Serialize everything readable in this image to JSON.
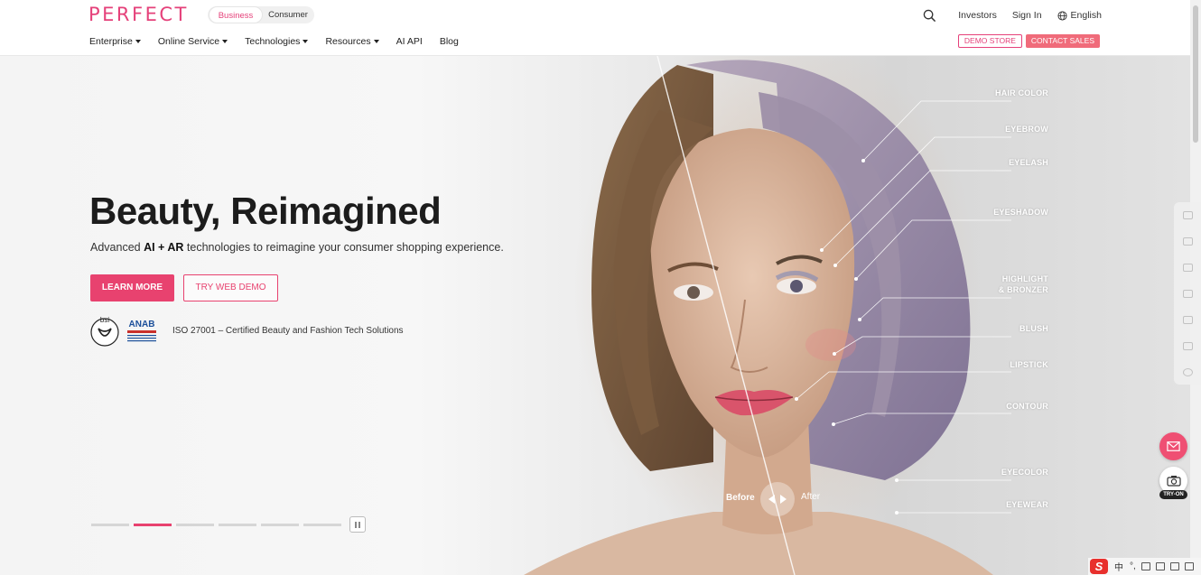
{
  "header": {
    "logo": "PERFECT",
    "toggle": {
      "active": "Business",
      "inactive": "Consumer"
    },
    "links": {
      "investors": "Investors",
      "sign_in": "Sign In",
      "language": "English"
    },
    "nav": [
      "Enterprise",
      "Online Service",
      "Technologies",
      "Resources",
      "AI API",
      "Blog"
    ],
    "nav_has_caret": [
      true,
      true,
      true,
      true,
      false,
      false
    ],
    "demo_store": "DEMO STORE",
    "contact_sales": "CONTACT SALES"
  },
  "hero": {
    "headline": "Beauty, Reimagined",
    "subline_prefix": "Advanced ",
    "subline_bold": "AI + AR",
    "subline_suffix": " technologies to reimagine your consumer shopping experience.",
    "learn_more": "LEARN MORE",
    "try_web_demo": "TRY WEB DEMO",
    "cert_text": "ISO 27001 – Certified Beauty and Fashion Tech Solutions",
    "bsi_mark": "bsi",
    "anab_mark": "ANAB",
    "before_label": "Before",
    "after_label": "After",
    "features": [
      {
        "label": "HAIR COLOR"
      },
      {
        "label": "EYEBROW"
      },
      {
        "label": "EYELASH"
      },
      {
        "label": "EYESHADOW"
      },
      {
        "label": "HIGHLIGHT\n& BRONZER"
      },
      {
        "label": "BLUSH"
      },
      {
        "label": "LIPSTICK"
      },
      {
        "label": "CONTOUR"
      },
      {
        "label": "EYECOLOR"
      },
      {
        "label": "EYEWEAR"
      }
    ]
  },
  "carousel": {
    "slides": 6,
    "active_index": 1
  },
  "widgets": {
    "tryon_label": "TRY-ON"
  },
  "taskbar": {
    "ime": "中",
    "punct": "°,"
  },
  "colors": {
    "brand_pink": "#e5417a",
    "button_pink": "#e8426f",
    "contact_pink": "#f06b7a"
  }
}
